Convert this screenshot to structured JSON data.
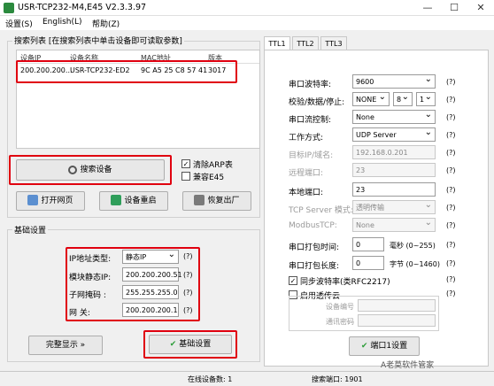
{
  "window": {
    "title": "USR-TCP232-M4,E45 V2.3.3.97"
  },
  "menu": [
    "设置(S)",
    "English(L)",
    "帮助(Z)"
  ],
  "search_group": {
    "label": "搜索列表 [在搜索列表中单击设备即可读取参数]"
  },
  "device_list": {
    "headers": [
      "设备IP",
      "设备名称",
      "MAC地址",
      "版本"
    ],
    "rows": [
      {
        "ip": "200.200.200...",
        "name": "USR-TCP232-ED2",
        "mac": "9C A5 25 C8 57 41",
        "version": "3017"
      }
    ]
  },
  "search_button": "搜索设备",
  "options": {
    "clear_arp": "清除ARP表",
    "clear_arp_checked": true,
    "compat_e45": "兼容E45",
    "compat_e45_checked": false
  },
  "actions": {
    "open_web": "打开网页",
    "restart": "设备重启",
    "factory": "恢复出厂"
  },
  "basic": {
    "label": "基础设置",
    "ip_type_label": "IP地址类型:",
    "ip_type_value": "静态IP",
    "static_ip_label": "模块静态IP:",
    "static_ip_value": "200.200.200.51",
    "mask_label": "子网掩码 :",
    "mask_value": "255.255.255.0",
    "gateway_label": "网    关:",
    "gateway_value": "200.200.200.1",
    "help": "(?)"
  },
  "full_display": "完整显示 »",
  "basic_set_button": "基础设置",
  "tabs": [
    "TTL1",
    "TTL2",
    "TTL3"
  ],
  "port": {
    "baud_label": "串口波特率:",
    "baud_value": "9600",
    "frame_label": "校验/数据/停止:",
    "parity_value": "NONE",
    "data_value": "8",
    "stop_value": "1",
    "flow_label": "串口流控制:",
    "flow_value": "None",
    "mode_label": "工作方式:",
    "mode_value": "UDP Server",
    "target_ip_label": "目标IP/域名:",
    "target_ip_value": "192.168.0.201",
    "remote_port_label": "远程端口:",
    "remote_port_value": "23",
    "local_port_label": "本地端口:",
    "local_port_value": "23",
    "tcp_mode_label": "TCP Server 模式:",
    "tcp_mode_value": "透明传输",
    "modbus_label": "ModbusTCP:",
    "modbus_value": "None",
    "pack_time_label": "串口打包时间:",
    "pack_time_value": "0",
    "pack_time_unit": "毫秒 (0~255)",
    "pack_len_label": "串口打包长度:",
    "pack_len_value": "0",
    "pack_len_unit": "字节 (0~1460)",
    "sync_baud_label": "同步波特率(类RFC2217)",
    "sync_baud_checked": true,
    "cloud_label": "启用透传云",
    "cloud_checked": false,
    "dev_id_label": "设备编号",
    "dev_pwd_label": "通讯密码",
    "help": "(?)"
  },
  "port_set_button": "端口1设置",
  "status": {
    "online": "在线设备数: 1",
    "search_port": "搜索端口: 1901"
  },
  "watermark": "A老莫软件管家"
}
